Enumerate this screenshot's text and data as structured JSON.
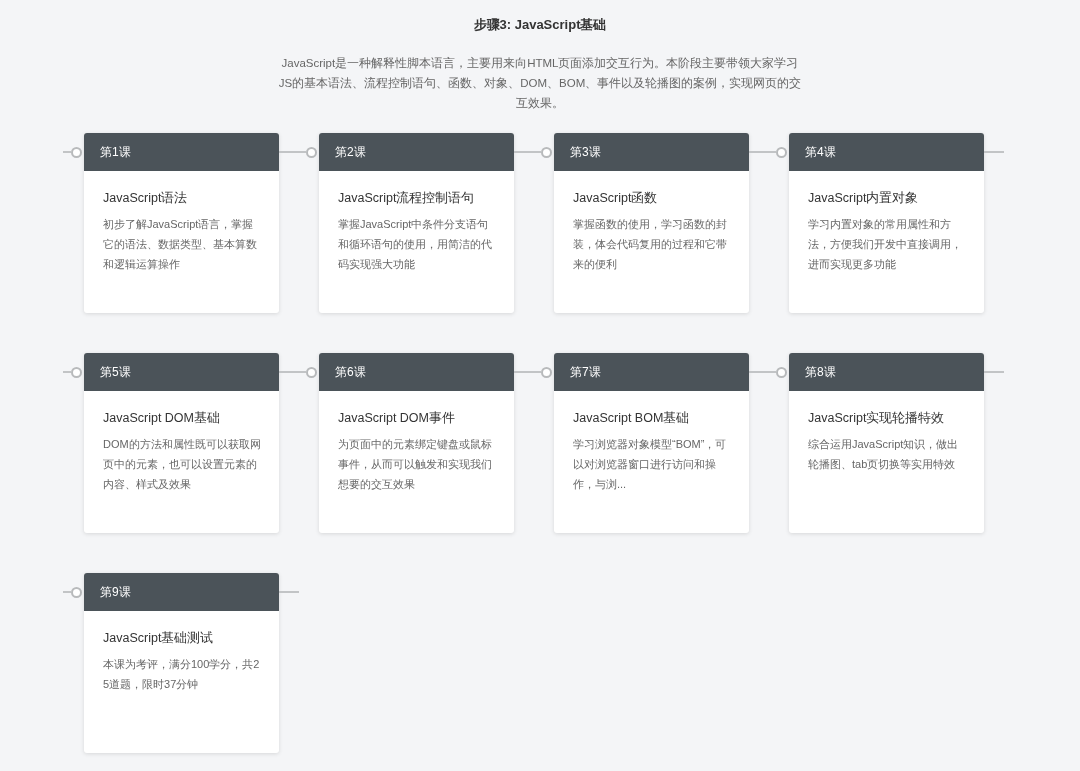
{
  "step_title": "步骤3: JavaScript基础",
  "step_description": "JavaScript是一种解释性脚本语言，主要用来向HTML页面添加交互行为。本阶段主要带领大家学习JS的基本语法、流程控制语句、函数、对象、DOM、BOM、事件以及轮播图的案例，实现网页的交互效果。",
  "lessons": [
    {
      "label": "第1课",
      "title": "JavaScript语法",
      "description": "初步了解JavaScript语言，掌握它的语法、数据类型、基本算数和逻辑运算操作"
    },
    {
      "label": "第2课",
      "title": "JavaScript流程控制语句",
      "description": "掌握JavaScript中条件分支语句和循环语句的使用，用简洁的代码实现强大功能"
    },
    {
      "label": "第3课",
      "title": "JavaScript函数",
      "description": "掌握函数的使用，学习函数的封装，体会代码复用的过程和它带来的便利"
    },
    {
      "label": "第4课",
      "title": "JavaScript内置对象",
      "description": "学习内置对象的常用属性和方法，方便我们开发中直接调用，进而实现更多功能"
    },
    {
      "label": "第5课",
      "title": "JavaScript DOM基础",
      "description": "DOM的方法和属性既可以获取网页中的元素，也可以设置元素的内容、样式及效果"
    },
    {
      "label": "第6课",
      "title": "JavaScript DOM事件",
      "description": "为页面中的元素绑定键盘或鼠标事件，从而可以触发和实现我们想要的交互效果"
    },
    {
      "label": "第7课",
      "title": "JavaScript BOM基础",
      "description": "学习浏览器对象模型“BOM”，可以对浏览器窗口进行访问和操作，与浏..."
    },
    {
      "label": "第8课",
      "title": "JavaScript实现轮播特效",
      "description": "综合运用JavaScript知识，做出轮播图、tab页切换等实用特效"
    },
    {
      "label": "第9课",
      "title": "JavaScript基础测试",
      "description": "本课为考评，满分100学分，共25道题，限时37分钟"
    }
  ]
}
